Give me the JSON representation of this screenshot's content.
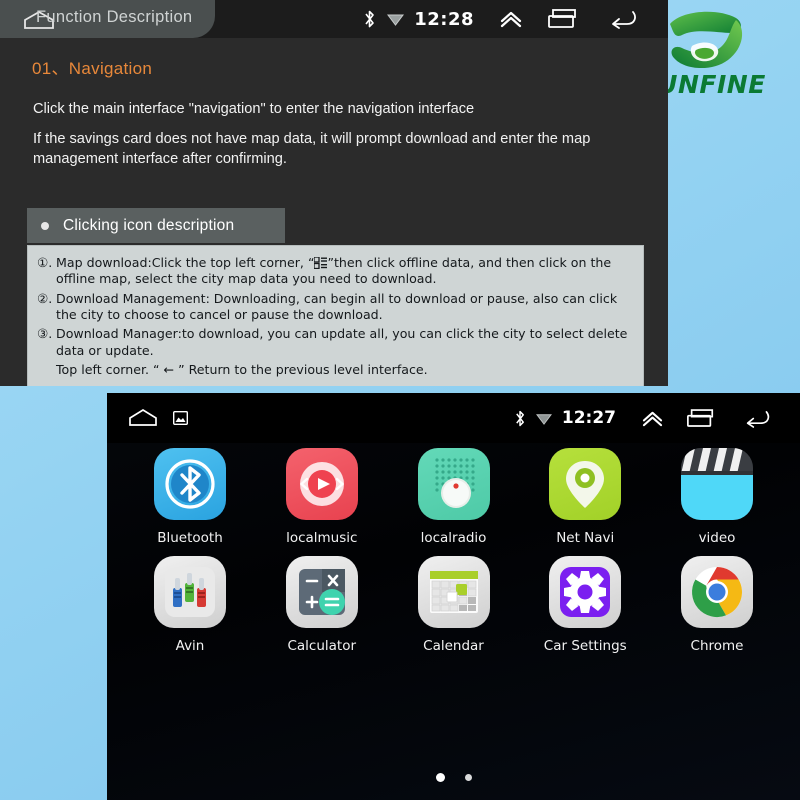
{
  "brand": {
    "name": "KUNFINE",
    "logo_icon": "kunfine-swirl-logo",
    "green": "#0b7a33",
    "backdrop": "#93d2f2"
  },
  "doc_panel": {
    "title": "Function Description",
    "home_icon": "home-icon",
    "status_bar": {
      "bluetooth_icon": "bluetooth-icon",
      "wifi_icon": "wifi-icon",
      "clock": "12:28",
      "expand_icon": "chevron-up-icon",
      "recents_icon": "recents-icon",
      "back_icon": "back-icon"
    },
    "heading": "01、Navigation",
    "paragraphs": [
      "Click the main interface \"navigation\" to enter the navigation interface",
      "If the savings card does not have map data, it will prompt download and enter the map management interface after confirming."
    ],
    "subheader": {
      "bullet_icon": "bullet-dot-icon",
      "label": "Clicking icon description"
    },
    "list": [
      {
        "num": "①.",
        "text_before": "Map download:Click the top left corner, “",
        "inline_icon": "list-grid-icon",
        "text_after": "”then click offline data, and then click on the offline map, select the city map data you need to download."
      },
      {
        "num": "②.",
        "text_before": "Download Management: Downloading, can begin all to download or pause, also can click the city to choose to cancel or pause the download.",
        "inline_icon": "",
        "text_after": ""
      },
      {
        "num": "③.",
        "text_before": "Download Manager:to download, you can update all, you can click the city to select delete data or update.",
        "inline_icon": "",
        "text_after": ""
      }
    ],
    "list_footnote": "Top left corner. “ ← ” Return to the previous level interface."
  },
  "launcher": {
    "status_bar": {
      "home_icon": "home-icon",
      "screenshot_icon": "screenshot-icon",
      "bluetooth_icon": "bluetooth-icon",
      "wifi_icon": "wifi-icon",
      "clock": "12:27",
      "expand_icon": "chevron-up-icon",
      "recents_icon": "recents-icon",
      "back_icon": "back-icon"
    },
    "apps": [
      [
        {
          "label": "Bluetooth",
          "icon": "bluetooth-app-icon",
          "color": "#3cb4ea"
        },
        {
          "label": "localmusic",
          "icon": "music-player-icon",
          "color": "#ee4f5b"
        },
        {
          "label": "localradio",
          "icon": "radio-icon",
          "color": "#57d2b0"
        },
        {
          "label": "Net Navi",
          "icon": "map-pin-icon",
          "color": "#aad833"
        },
        {
          "label": "video",
          "icon": "clapperboard-icon",
          "color": "#4fd8f8"
        }
      ],
      [
        {
          "label": "Avin",
          "icon": "av-input-plugs-icon",
          "color": "#e2e2e2"
        },
        {
          "label": "Calculator",
          "icon": "calculator-icon",
          "color": "#e2e2e2"
        },
        {
          "label": "Calendar",
          "icon": "calendar-icon",
          "color": "#e2e2e2"
        },
        {
          "label": "Car Settings",
          "icon": "gear-icon",
          "color": "#7b1ff0"
        },
        {
          "label": "Chrome",
          "icon": "chrome-icon",
          "color": "#e2e2e2"
        }
      ]
    ],
    "page_dots": {
      "count": 2,
      "active_index": 0
    }
  }
}
